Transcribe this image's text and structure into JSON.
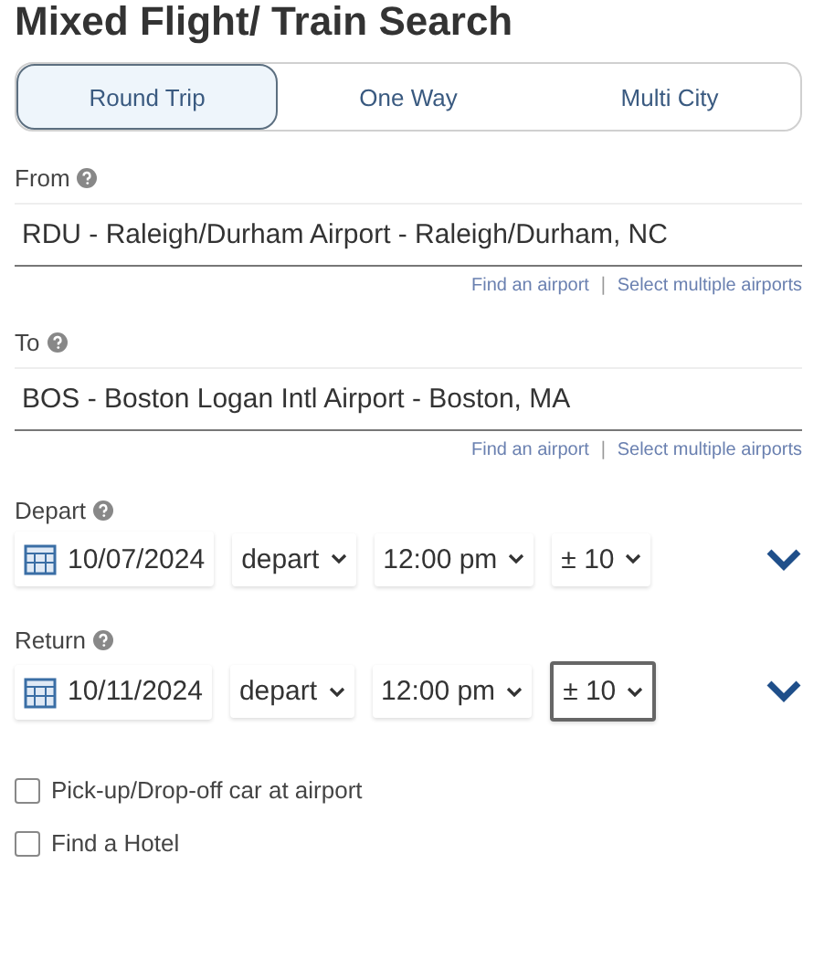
{
  "title": "Mixed Flight/ Train Search",
  "tabs": [
    {
      "label": "Round Trip",
      "selected": true
    },
    {
      "label": "One Way",
      "selected": false
    },
    {
      "label": "Multi City",
      "selected": false
    }
  ],
  "locations": [
    {
      "label": "From",
      "value": "RDU - Raleigh/Durham Airport - Raleigh/Durham, NC",
      "links": [
        "Find an airport",
        "Select multiple airports"
      ],
      "separator": "|"
    },
    {
      "label": "To",
      "value": "BOS - Boston Logan Intl Airport - Boston, MA",
      "links": [
        "Find an airport",
        "Select multiple airports"
      ],
      "separator": "|"
    }
  ],
  "dates": [
    {
      "label": "Depart",
      "date": "10/07/2024",
      "mode": "depart",
      "time": "12:00 pm",
      "window": "± 10",
      "window_focused": false
    },
    {
      "label": "Return",
      "date": "10/11/2024",
      "mode": "depart",
      "time": "12:00 pm",
      "window": "± 10",
      "window_focused": true
    }
  ],
  "options": [
    {
      "label": "Pick-up/Drop-off car at airport",
      "checked": false
    },
    {
      "label": "Find a Hotel",
      "checked": false
    }
  ]
}
